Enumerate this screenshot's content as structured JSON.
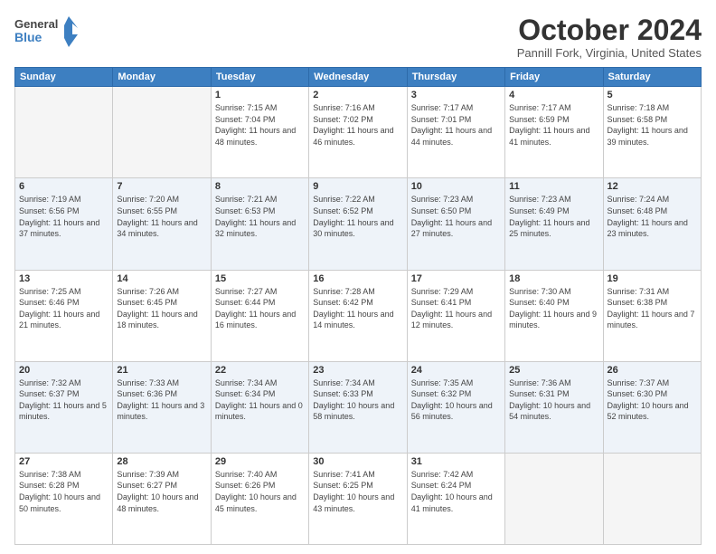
{
  "header": {
    "logo_line1": "General",
    "logo_line2": "Blue",
    "month": "October 2024",
    "location": "Pannill Fork, Virginia, United States"
  },
  "days_of_week": [
    "Sunday",
    "Monday",
    "Tuesday",
    "Wednesday",
    "Thursday",
    "Friday",
    "Saturday"
  ],
  "weeks": [
    [
      {
        "day": "",
        "empty": true
      },
      {
        "day": "",
        "empty": true
      },
      {
        "day": "1",
        "sunrise": "Sunrise: 7:15 AM",
        "sunset": "Sunset: 7:04 PM",
        "daylight": "Daylight: 11 hours and 48 minutes."
      },
      {
        "day": "2",
        "sunrise": "Sunrise: 7:16 AM",
        "sunset": "Sunset: 7:02 PM",
        "daylight": "Daylight: 11 hours and 46 minutes."
      },
      {
        "day": "3",
        "sunrise": "Sunrise: 7:17 AM",
        "sunset": "Sunset: 7:01 PM",
        "daylight": "Daylight: 11 hours and 44 minutes."
      },
      {
        "day": "4",
        "sunrise": "Sunrise: 7:17 AM",
        "sunset": "Sunset: 6:59 PM",
        "daylight": "Daylight: 11 hours and 41 minutes."
      },
      {
        "day": "5",
        "sunrise": "Sunrise: 7:18 AM",
        "sunset": "Sunset: 6:58 PM",
        "daylight": "Daylight: 11 hours and 39 minutes."
      }
    ],
    [
      {
        "day": "6",
        "sunrise": "Sunrise: 7:19 AM",
        "sunset": "Sunset: 6:56 PM",
        "daylight": "Daylight: 11 hours and 37 minutes."
      },
      {
        "day": "7",
        "sunrise": "Sunrise: 7:20 AM",
        "sunset": "Sunset: 6:55 PM",
        "daylight": "Daylight: 11 hours and 34 minutes."
      },
      {
        "day": "8",
        "sunrise": "Sunrise: 7:21 AM",
        "sunset": "Sunset: 6:53 PM",
        "daylight": "Daylight: 11 hours and 32 minutes."
      },
      {
        "day": "9",
        "sunrise": "Sunrise: 7:22 AM",
        "sunset": "Sunset: 6:52 PM",
        "daylight": "Daylight: 11 hours and 30 minutes."
      },
      {
        "day": "10",
        "sunrise": "Sunrise: 7:23 AM",
        "sunset": "Sunset: 6:50 PM",
        "daylight": "Daylight: 11 hours and 27 minutes."
      },
      {
        "day": "11",
        "sunrise": "Sunrise: 7:23 AM",
        "sunset": "Sunset: 6:49 PM",
        "daylight": "Daylight: 11 hours and 25 minutes."
      },
      {
        "day": "12",
        "sunrise": "Sunrise: 7:24 AM",
        "sunset": "Sunset: 6:48 PM",
        "daylight": "Daylight: 11 hours and 23 minutes."
      }
    ],
    [
      {
        "day": "13",
        "sunrise": "Sunrise: 7:25 AM",
        "sunset": "Sunset: 6:46 PM",
        "daylight": "Daylight: 11 hours and 21 minutes."
      },
      {
        "day": "14",
        "sunrise": "Sunrise: 7:26 AM",
        "sunset": "Sunset: 6:45 PM",
        "daylight": "Daylight: 11 hours and 18 minutes."
      },
      {
        "day": "15",
        "sunrise": "Sunrise: 7:27 AM",
        "sunset": "Sunset: 6:44 PM",
        "daylight": "Daylight: 11 hours and 16 minutes."
      },
      {
        "day": "16",
        "sunrise": "Sunrise: 7:28 AM",
        "sunset": "Sunset: 6:42 PM",
        "daylight": "Daylight: 11 hours and 14 minutes."
      },
      {
        "day": "17",
        "sunrise": "Sunrise: 7:29 AM",
        "sunset": "Sunset: 6:41 PM",
        "daylight": "Daylight: 11 hours and 12 minutes."
      },
      {
        "day": "18",
        "sunrise": "Sunrise: 7:30 AM",
        "sunset": "Sunset: 6:40 PM",
        "daylight": "Daylight: 11 hours and 9 minutes."
      },
      {
        "day": "19",
        "sunrise": "Sunrise: 7:31 AM",
        "sunset": "Sunset: 6:38 PM",
        "daylight": "Daylight: 11 hours and 7 minutes."
      }
    ],
    [
      {
        "day": "20",
        "sunrise": "Sunrise: 7:32 AM",
        "sunset": "Sunset: 6:37 PM",
        "daylight": "Daylight: 11 hours and 5 minutes."
      },
      {
        "day": "21",
        "sunrise": "Sunrise: 7:33 AM",
        "sunset": "Sunset: 6:36 PM",
        "daylight": "Daylight: 11 hours and 3 minutes."
      },
      {
        "day": "22",
        "sunrise": "Sunrise: 7:34 AM",
        "sunset": "Sunset: 6:34 PM",
        "daylight": "Daylight: 11 hours and 0 minutes."
      },
      {
        "day": "23",
        "sunrise": "Sunrise: 7:34 AM",
        "sunset": "Sunset: 6:33 PM",
        "daylight": "Daylight: 10 hours and 58 minutes."
      },
      {
        "day": "24",
        "sunrise": "Sunrise: 7:35 AM",
        "sunset": "Sunset: 6:32 PM",
        "daylight": "Daylight: 10 hours and 56 minutes."
      },
      {
        "day": "25",
        "sunrise": "Sunrise: 7:36 AM",
        "sunset": "Sunset: 6:31 PM",
        "daylight": "Daylight: 10 hours and 54 minutes."
      },
      {
        "day": "26",
        "sunrise": "Sunrise: 7:37 AM",
        "sunset": "Sunset: 6:30 PM",
        "daylight": "Daylight: 10 hours and 52 minutes."
      }
    ],
    [
      {
        "day": "27",
        "sunrise": "Sunrise: 7:38 AM",
        "sunset": "Sunset: 6:28 PM",
        "daylight": "Daylight: 10 hours and 50 minutes."
      },
      {
        "day": "28",
        "sunrise": "Sunrise: 7:39 AM",
        "sunset": "Sunset: 6:27 PM",
        "daylight": "Daylight: 10 hours and 48 minutes."
      },
      {
        "day": "29",
        "sunrise": "Sunrise: 7:40 AM",
        "sunset": "Sunset: 6:26 PM",
        "daylight": "Daylight: 10 hours and 45 minutes."
      },
      {
        "day": "30",
        "sunrise": "Sunrise: 7:41 AM",
        "sunset": "Sunset: 6:25 PM",
        "daylight": "Daylight: 10 hours and 43 minutes."
      },
      {
        "day": "31",
        "sunrise": "Sunrise: 7:42 AM",
        "sunset": "Sunset: 6:24 PM",
        "daylight": "Daylight: 10 hours and 41 minutes."
      },
      {
        "day": "",
        "empty": true
      },
      {
        "day": "",
        "empty": true
      }
    ]
  ]
}
